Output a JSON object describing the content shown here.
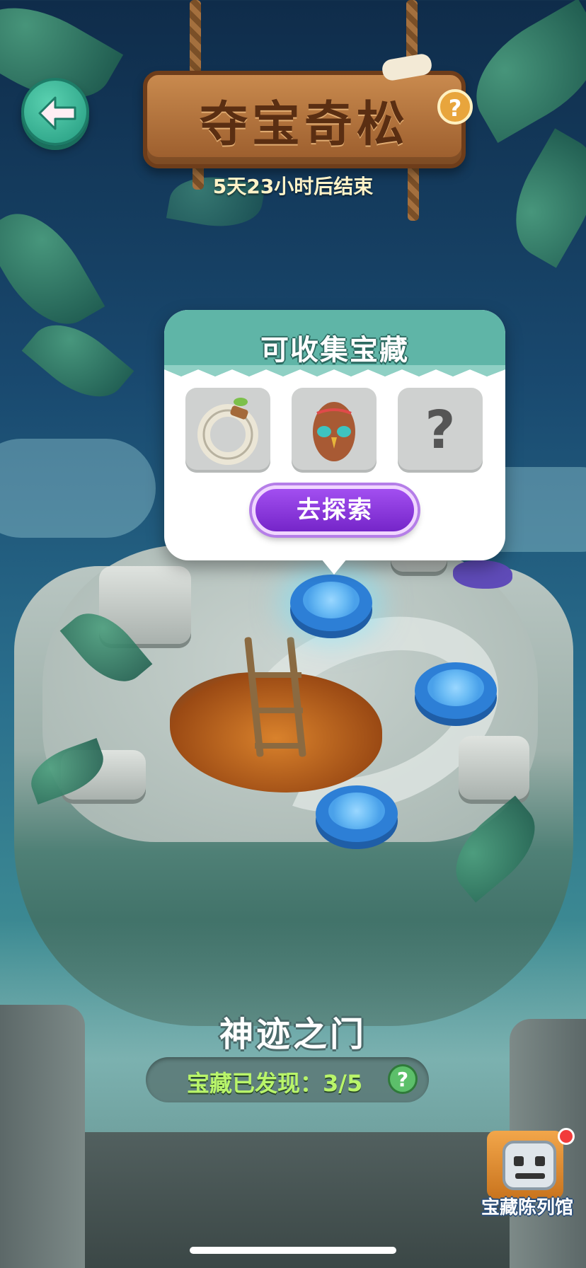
{
  "header": {
    "title": "夺宝奇松",
    "help_label": "?",
    "countdown": "5天23小时后结束"
  },
  "popup": {
    "title": "可收集宝藏",
    "items": [
      {
        "name": "bone-ring-icon"
      },
      {
        "name": "tiki-egg-icon"
      },
      {
        "name": "unknown-item",
        "label": "?"
      }
    ],
    "explore_button": "去探索"
  },
  "stage": {
    "name": "神迹之门",
    "treasures_found": "宝藏已发现：3/5",
    "help_label": "?"
  },
  "museum": {
    "label": "宝藏陈列馆",
    "has_notification": true
  },
  "colors": {
    "popup_header": "#5fb5a7",
    "explore_button": "#8a36dc",
    "found_text": "#b9f56a",
    "sign_wood": "#b7773f"
  }
}
